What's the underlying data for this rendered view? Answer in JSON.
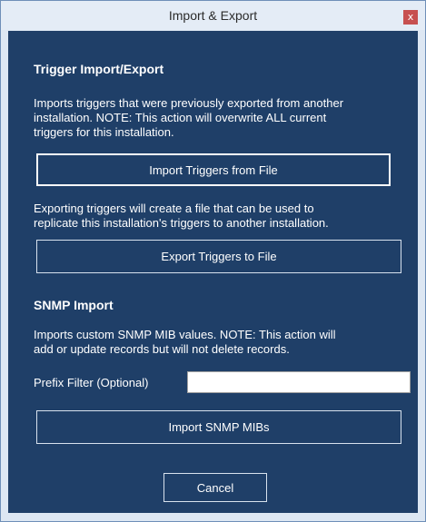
{
  "window": {
    "title": "Import & Export",
    "close_glyph": "x"
  },
  "triggers": {
    "heading": "Trigger Import/Export",
    "import_description": [
      "Imports triggers that were previously exported from another",
      "installation.  NOTE: This action will overwrite ALL current",
      "triggers for this installation."
    ],
    "import_button": "Import Triggers from File",
    "export_description": [
      "Exporting triggers will create a file that can be used to",
      "replicate this installation's triggers to another installation."
    ],
    "export_button": "Export Triggers to File"
  },
  "snmp": {
    "heading": "SNMP Import",
    "description": [
      "Imports custom SNMP MIB values.  NOTE: This action will",
      "add or update records but will not delete records."
    ],
    "prefix_label": "Prefix Filter (Optional)",
    "prefix_value": "",
    "import_button": "Import SNMP MIBs"
  },
  "footer": {
    "cancel_button": "Cancel"
  },
  "colors": {
    "client_background": "#1f3f68",
    "titlebar_background": "#e4ecf6",
    "close_button": "#c75050"
  }
}
